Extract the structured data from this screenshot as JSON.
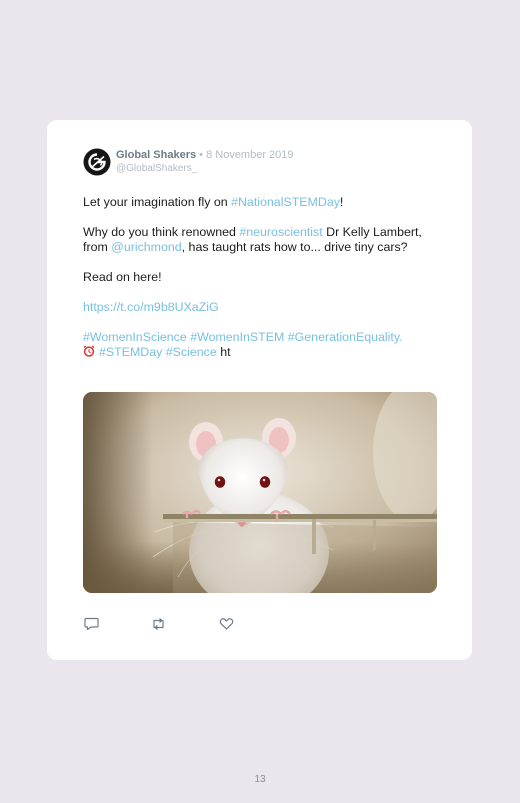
{
  "tweet_card": {
    "author_name": "Global Shakers",
    "separator": "•",
    "date": "8 November 2019",
    "handle": "@GlobalShakers_",
    "body": {
      "p1_prefix": "Let your imagination fly on ",
      "p1_tag": "#NationalSTEMDay",
      "p1_suffix": "!",
      "p2_a": "Why do you think renowned ",
      "p2_tag": "#neuroscientist",
      "p2_b": " Dr Kelly Lambert, from ",
      "p2_mention": "@urichmond",
      "p2_c": ", has taught rats how to... drive tiny cars?",
      "p3": "Read on here!",
      "p4_link": "https://t.co/m9b8UXaZiG",
      "p5_tags": "#WomenInScience #WomenInSTEM #GenerationEquality.",
      "p6_tags": "#STEMDay #Science",
      "p6_suffix": " ht"
    },
    "icons": {
      "avatar": "global-shakers-logo",
      "clock": "alarm-clock-icon",
      "reply": "reply-icon",
      "retweet": "retweet-icon",
      "like": "heart-icon"
    }
  },
  "page_number": "13",
  "colors": {
    "background": "#ebe6ee",
    "card": "#ffffff",
    "link": "#79c0df",
    "author": "#6e7c89",
    "muted": "#b2bcc5"
  }
}
